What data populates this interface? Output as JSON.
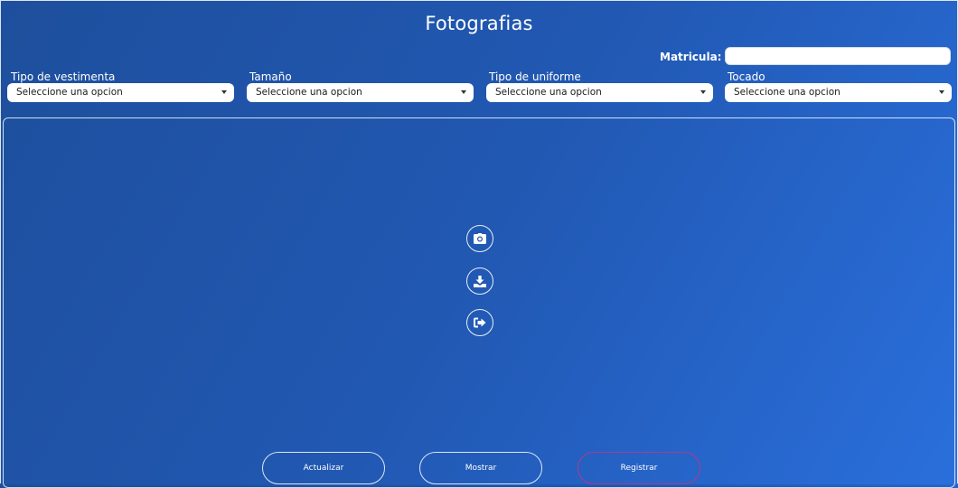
{
  "header": {
    "title": "Fotografias"
  },
  "matricula": {
    "label": "Matricula:",
    "value": ""
  },
  "filters": [
    {
      "label": "Tipo de vestimenta",
      "selected": "Seleccione una opcion"
    },
    {
      "label": "Tamaño",
      "selected": "Seleccione una opcion"
    },
    {
      "label": "Tipo de uniforme",
      "selected": "Seleccione una opcion"
    },
    {
      "label": "Tocado",
      "selected": "Seleccione una opcion"
    }
  ],
  "photo_tools": [
    {
      "icon": "camera-icon"
    },
    {
      "icon": "download-icon"
    },
    {
      "icon": "exit-icon"
    }
  ],
  "actions": {
    "update_label": "Actualizar",
    "show_label": "Mostrar",
    "register_label": "Registrar"
  },
  "colors": {
    "background_start": "#1e4f9d",
    "background_end": "#2a6fdc",
    "register_border": "#b03a8c"
  }
}
